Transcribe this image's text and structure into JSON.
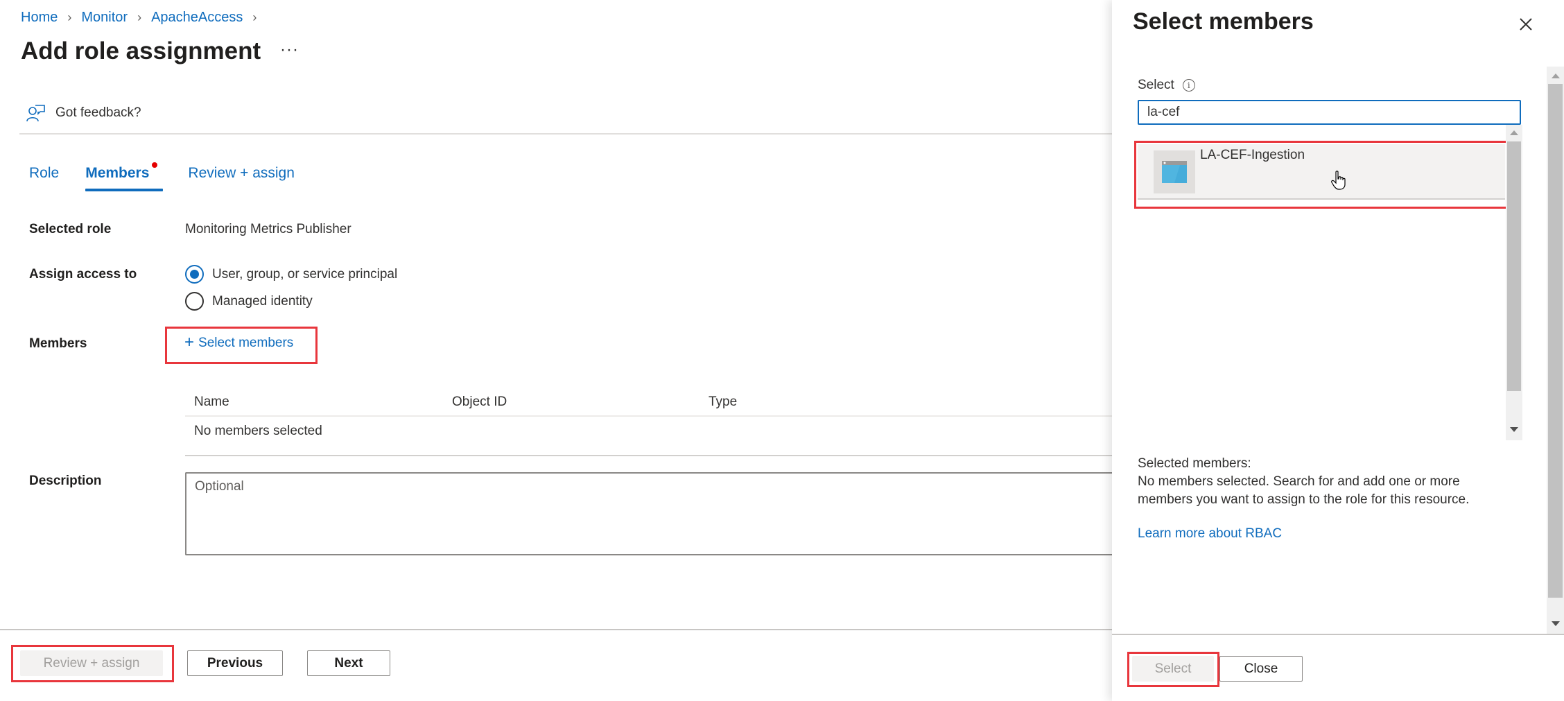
{
  "breadcrumb": {
    "items": [
      "Home",
      "Monitor",
      "ApacheAccess"
    ],
    "separator_icon": "chevron-right-icon"
  },
  "page": {
    "title": "Add role assignment",
    "more_label": "···"
  },
  "feedback": {
    "label": "Got feedback?",
    "icon": "feedback-person-icon"
  },
  "tabs": [
    {
      "label": "Role",
      "active": false
    },
    {
      "label": "Members",
      "active": true,
      "has_indicator": true
    },
    {
      "label": "Review + assign",
      "active": false
    }
  ],
  "form": {
    "selected_role_label": "Selected role",
    "selected_role_value": "Monitoring Metrics Publisher",
    "assign_access_label": "Assign access to",
    "assign_access_options": [
      {
        "label": "User, group, or service principal",
        "checked": true
      },
      {
        "label": "Managed identity",
        "checked": false
      }
    ],
    "members_label": "Members",
    "select_members_label": "Select members",
    "select_members_icon": "plus-icon",
    "table": {
      "columns": [
        "Name",
        "Object ID",
        "Type"
      ],
      "empty_text": "No members selected"
    },
    "description_label": "Description",
    "description_placeholder": "Optional",
    "description_value": ""
  },
  "footer": {
    "review_assign_label": "Review + assign",
    "review_assign_disabled": true,
    "previous_label": "Previous",
    "next_label": "Next"
  },
  "panel": {
    "title": "Select members",
    "close_icon": "close-icon",
    "select_label": "Select",
    "info_icon": "info-icon",
    "info_glyph": "i",
    "search_value": "la-cef",
    "results": [
      {
        "name": "LA-CEF-Ingestion",
        "icon": "app-registration-icon"
      }
    ],
    "selected_members_heading": "Selected members:",
    "selected_members_text": "No members selected. Search for and add one or more members you want to assign to the role for this resource.",
    "learn_more_label": "Learn more about RBAC",
    "select_button_label": "Select",
    "select_button_disabled": true,
    "close_button_label": "Close"
  },
  "colors": {
    "accent": "#0f6cbd",
    "highlight_border": "#e8363c",
    "indicator_dot": "#e50000",
    "app_icon": "#50b5e0"
  }
}
